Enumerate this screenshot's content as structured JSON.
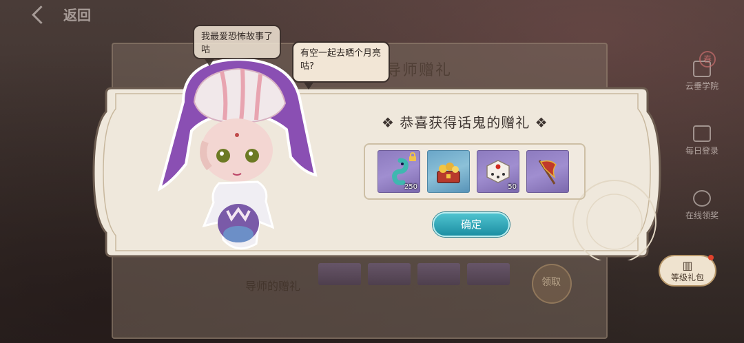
{
  "header": {
    "back_label": "返回"
  },
  "background": {
    "panel_title": "导师赠礼",
    "panel_subtitle": "导师的赠礼",
    "receive_label": "领取"
  },
  "sidebar": {
    "items": [
      {
        "label": "云垂学院",
        "icon": "academy-icon"
      },
      {
        "label": "每日登录",
        "icon": "shield-icon"
      },
      {
        "label": "在线领奖",
        "icon": "online-reward-icon"
      }
    ],
    "level_gift": {
      "label": "等级礼包",
      "icon": "gift-icon",
      "has_badge": true
    },
    "seal_text": "春"
  },
  "bubbles": {
    "first": "我最爱恐怖故事了咕",
    "second": "有空一起去晒个月亮咕?"
  },
  "dialog": {
    "title": "❖ 恭喜获得话鬼的赠礼 ❖",
    "items": [
      {
        "name": "seahorse-token",
        "icon": "seahorse-icon",
        "quantity": "250",
        "locked": true,
        "rarity": "purple"
      },
      {
        "name": "treasure-chest",
        "icon": "treasure-icon",
        "quantity": "",
        "locked": false,
        "rarity": "blue"
      },
      {
        "name": "dice",
        "icon": "dice-icon",
        "quantity": "50",
        "locked": false,
        "rarity": "purple"
      },
      {
        "name": "banner-flag",
        "icon": "flag-icon",
        "quantity": "",
        "locked": false,
        "rarity": "purple"
      }
    ],
    "confirm_label": "确定"
  },
  "colors": {
    "dialog_bg": "#efe8dc",
    "dialog_border": "#6b5b4f",
    "confirm_button": "#2aa3b5",
    "item_purple": "#8d7bbf",
    "item_blue": "#6aa6c8"
  }
}
